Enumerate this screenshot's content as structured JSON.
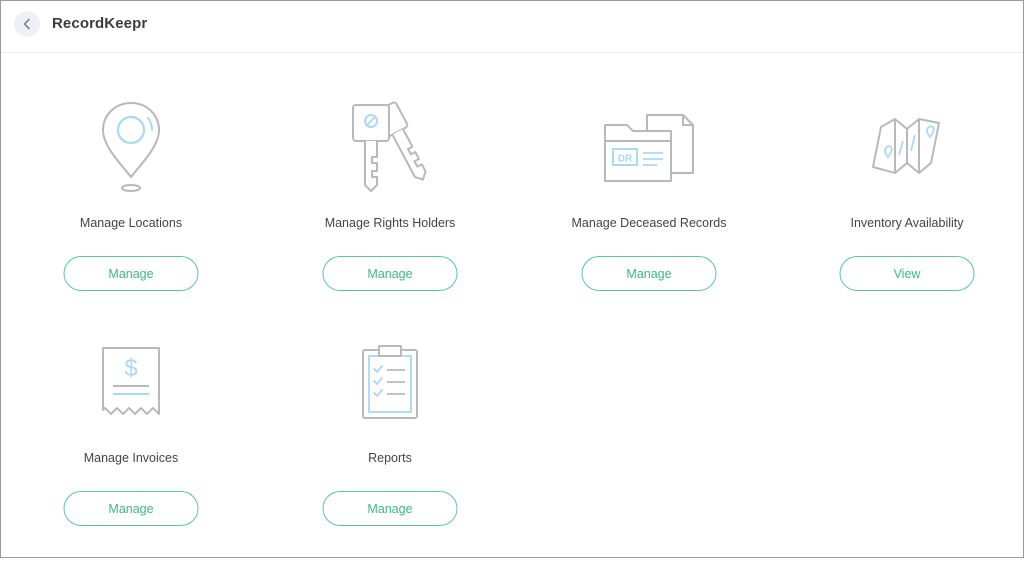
{
  "app": {
    "title": "RecordKeepr"
  },
  "tiles": [
    {
      "label": "Manage Locations",
      "button": "Manage"
    },
    {
      "label": "Manage Rights Holders",
      "button": "Manage"
    },
    {
      "label": "Manage Deceased Records",
      "button": "Manage",
      "icon_text": "DR"
    },
    {
      "label": "Inventory Availability",
      "button": "View"
    },
    {
      "label": "Manage Invoices",
      "button": "Manage",
      "icon_text": "$"
    },
    {
      "label": "Reports",
      "button": "Manage"
    }
  ],
  "colors": {
    "accent": "#3fb982",
    "icon_gray": "#b9b9b9",
    "icon_blue": "#a9d9f5"
  }
}
